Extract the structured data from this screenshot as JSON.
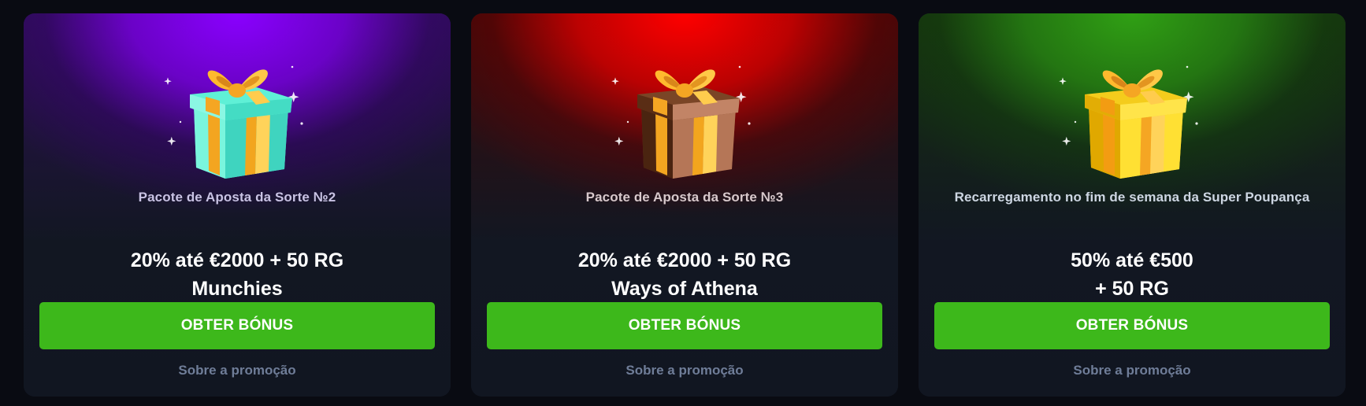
{
  "colors": {
    "page_bg": "#090b12",
    "card_bg": "#121722",
    "cta_bg": "#3db81b",
    "cta_text": "#ffffff",
    "link_text": "#6f7d98",
    "glow_purple": "#8a00ff",
    "glow_red": "#ff0000",
    "glow_green": "#30a014"
  },
  "cards": [
    {
      "theme": "purple",
      "gift_icon": "gift-box-teal-icon",
      "title": "Pacote de Aposta da Sorte №2",
      "offer_line1": "20% até €2000 + 50 RG",
      "offer_line2": "Munchies",
      "cta_label": "OBTER BÓNUS",
      "link_label": "Sobre a promoção"
    },
    {
      "theme": "red",
      "gift_icon": "gift-box-brown-icon",
      "title": "Pacote de Aposta da Sorte №3",
      "offer_line1": "20% até €2000 + 50 RG",
      "offer_line2": "Ways of Athena",
      "cta_label": "OBTER BÓNUS",
      "link_label": "Sobre a promoção"
    },
    {
      "theme": "green",
      "gift_icon": "gift-box-yellow-icon",
      "title": "Recarregamento no fim de semana da Super Poupança",
      "offer_line1": "50% até €500",
      "offer_line2": "+ 50 RG",
      "cta_label": "OBTER BÓNUS",
      "link_label": "Sobre a promoção"
    }
  ]
}
